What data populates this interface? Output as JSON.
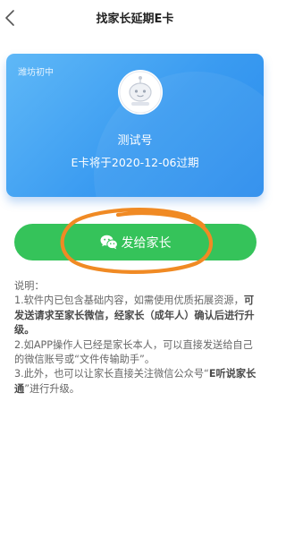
{
  "header": {
    "title": "找家长延期E卡"
  },
  "card": {
    "school": "潍坊初中",
    "account_name": "测试号",
    "expiry_text": "E卡将于2020-12-06过期",
    "gradient": [
      "#5fb8f7",
      "#2a8cec"
    ]
  },
  "send_button": {
    "label": "发给家长",
    "icon": "wechat-icon",
    "color": "#35c35a"
  },
  "annotation": {
    "color": "#f08a24"
  },
  "notes": {
    "heading": "说明：",
    "item1_prefix": "1.软件内已包含基础内容，如需使用优质拓展资源，",
    "item1_bold": "可发送请求至家长微信，经家长（成年人）确认后进行升级。",
    "item2": "2.如APP操作人已经是家长本人，可以直接发送给自己的微信账号或“文件传输助手”。",
    "item3_prefix": "3.此外，也可以让家长直接关注微信公众号“",
    "item3_bold": "E听说家长通",
    "item3_suffix": "”进行升级。"
  }
}
